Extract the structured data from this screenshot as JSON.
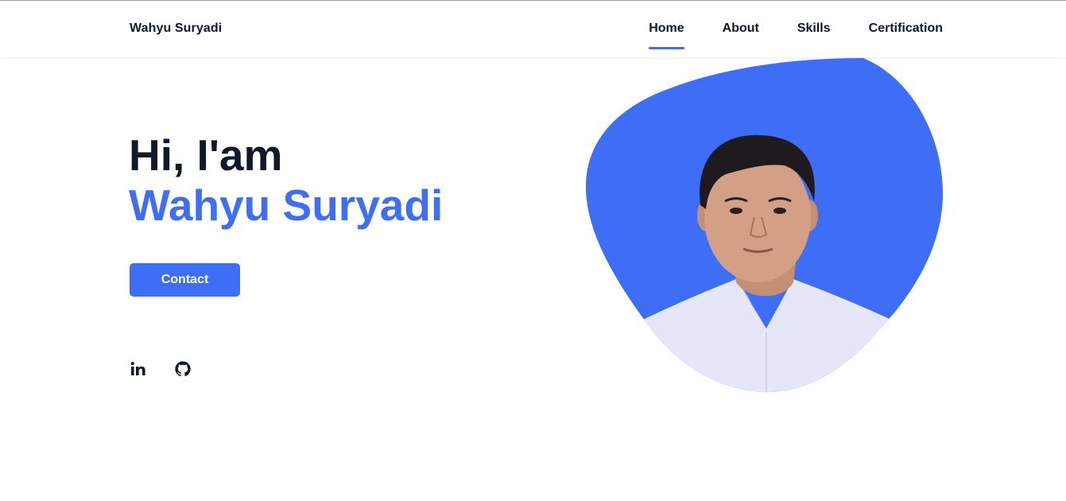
{
  "header": {
    "logo": "Wahyu Suryadi",
    "nav": [
      {
        "label": "Home",
        "active": true
      },
      {
        "label": "About",
        "active": false
      },
      {
        "label": "Skills",
        "active": false
      },
      {
        "label": "Certification",
        "active": false
      }
    ]
  },
  "hero": {
    "greeting": "Hi, I'am",
    "name": "Wahyu Suryadi",
    "contact_label": "Contact"
  },
  "social": {
    "icons": [
      "linkedin-icon",
      "github-icon"
    ]
  },
  "colors": {
    "accent": "#3d6ef5",
    "text": "#111827",
    "background": "#ffffff"
  }
}
